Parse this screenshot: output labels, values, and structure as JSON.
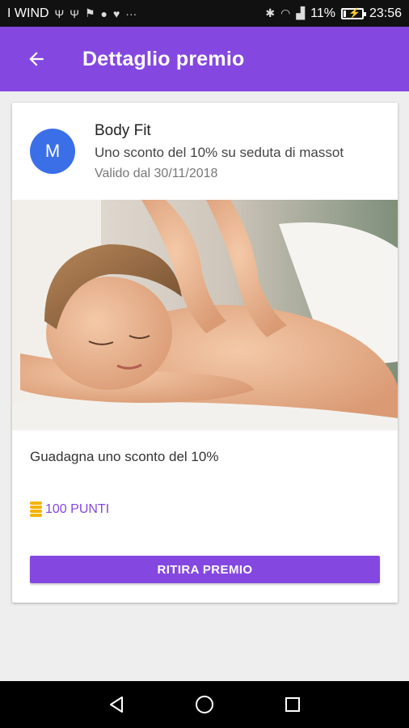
{
  "status_bar": {
    "carrier": "I WIND",
    "notification_icons": [
      "usb-icon",
      "usb-icon",
      "android-debug-icon",
      "messenger-icon",
      "twitter-icon",
      "more-icon"
    ],
    "battery_percent": "11%",
    "battery_level": 0.11,
    "time": "23:56"
  },
  "app_bar": {
    "title": "Dettaglio premio",
    "back_icon": "arrow-left-icon"
  },
  "reward": {
    "avatar_letter": "M",
    "avatar_color": "#3a6fe7",
    "brand": "Body Fit",
    "subtitle": "Uno sconto del 10% su seduta di massot",
    "validity": "Valido dal 30/11/2018",
    "description": "Guadagna uno sconto del 10%",
    "points": "100 PUNTI",
    "redeem_label": "RITIRA PREMIO"
  },
  "colors": {
    "accent": "#8448e0",
    "coin": "#f4b300"
  },
  "nav_bar": {
    "buttons": [
      "back-triangle-icon",
      "home-circle-icon",
      "recents-square-icon"
    ]
  }
}
